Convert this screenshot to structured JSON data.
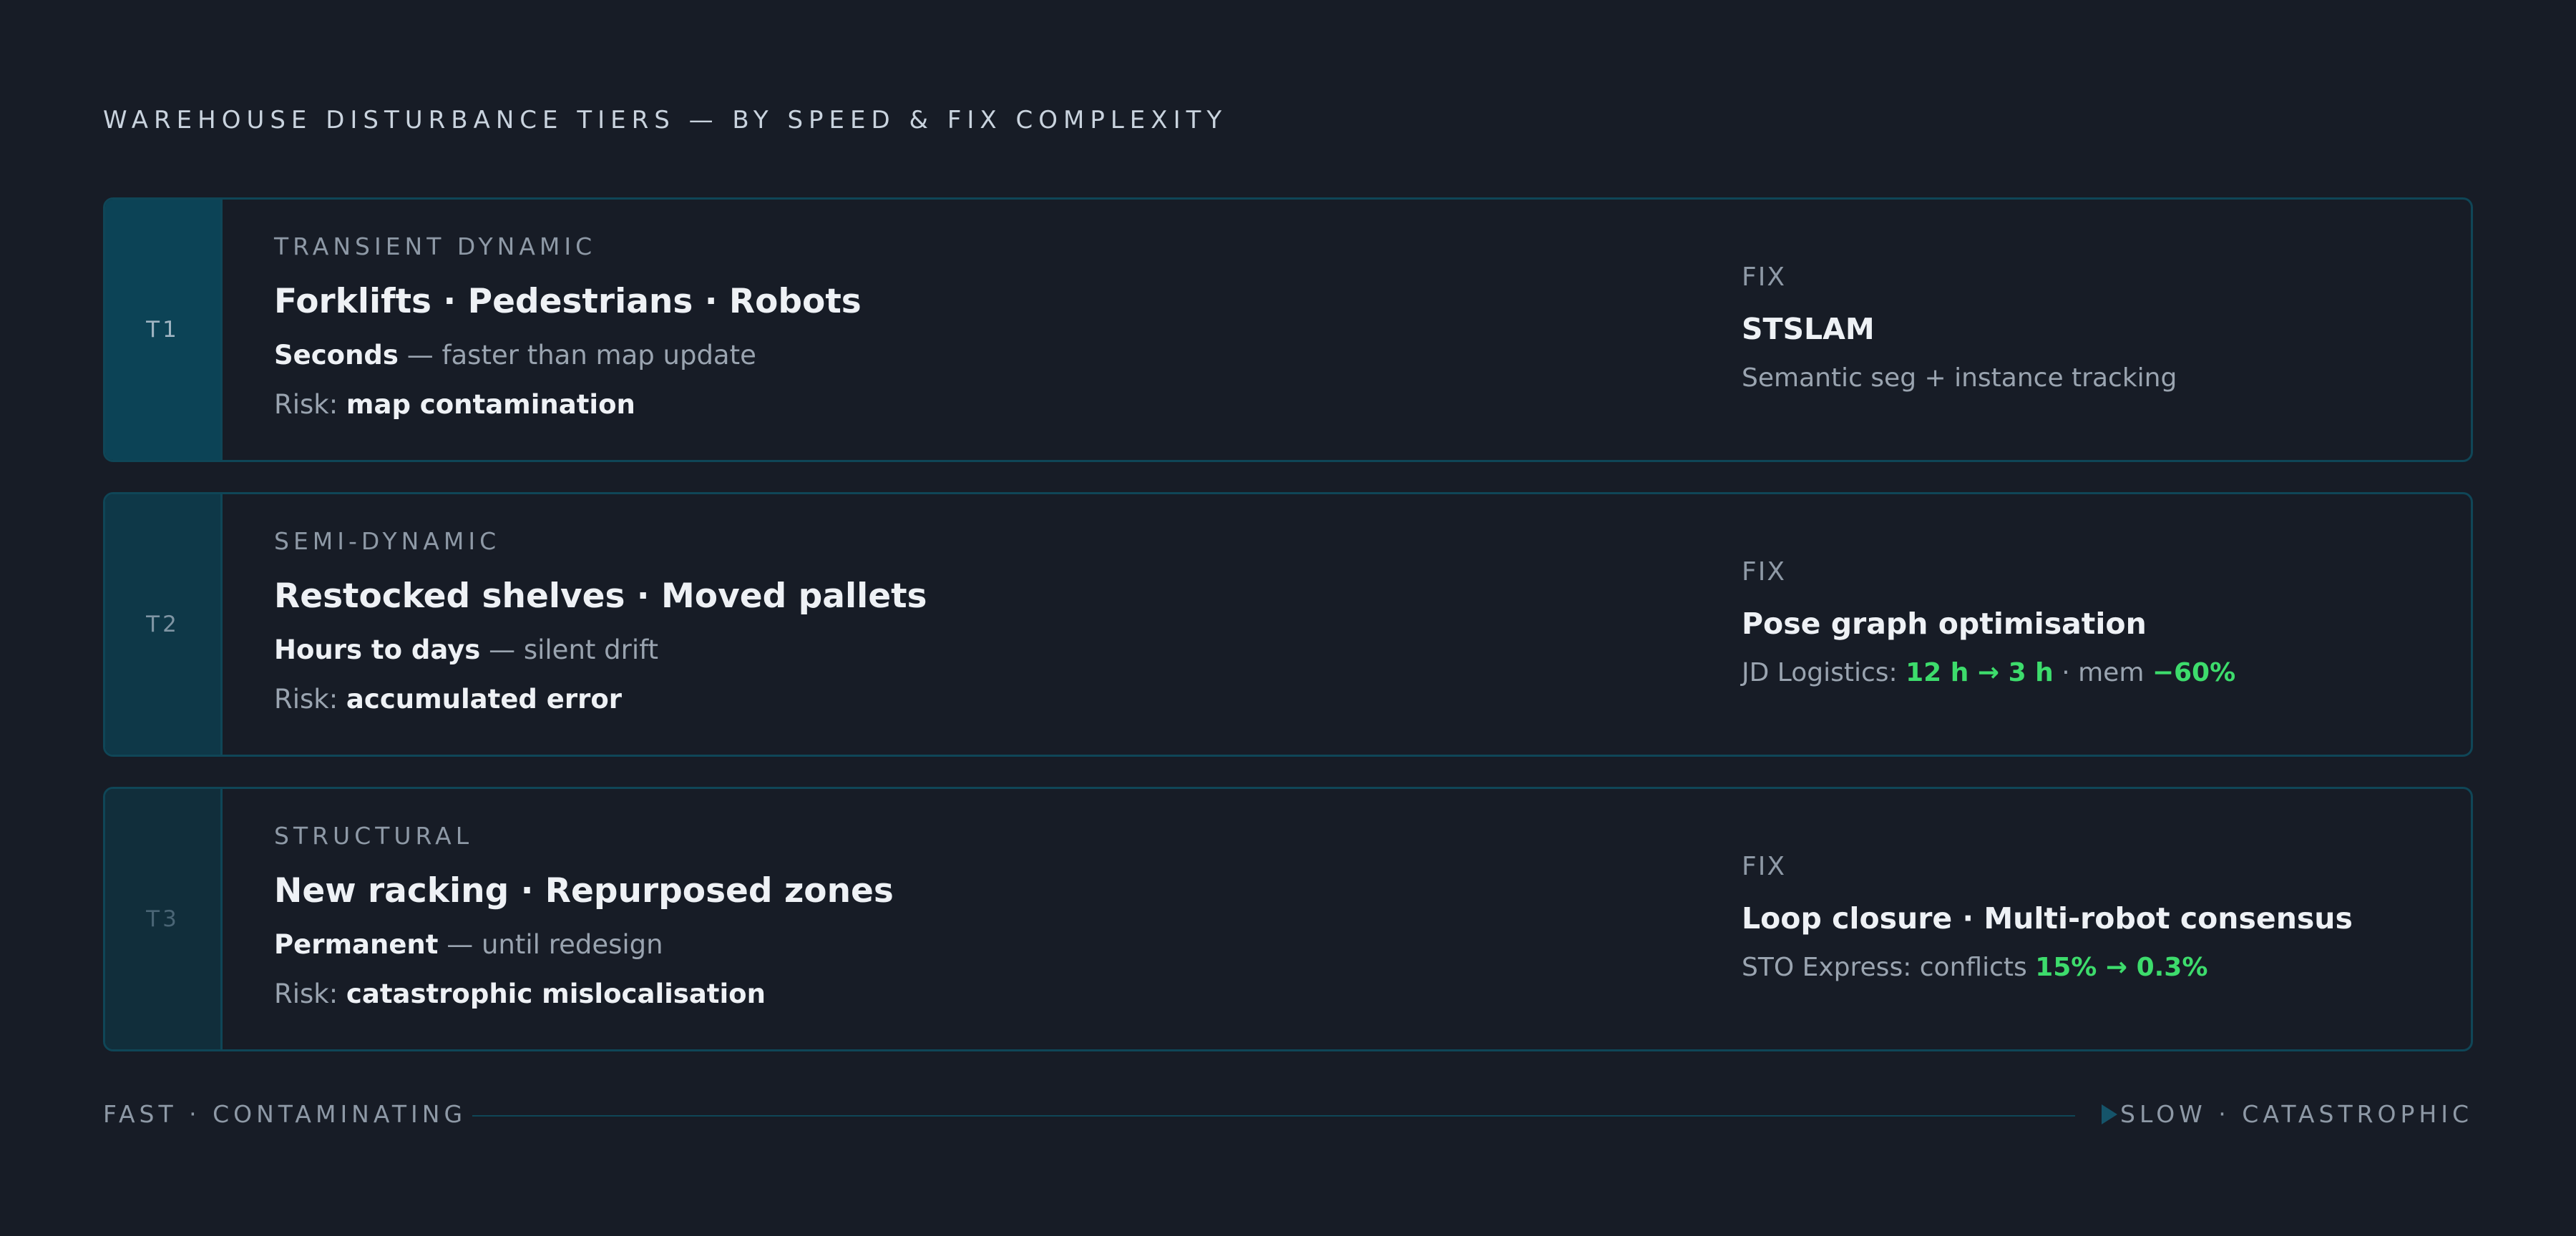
{
  "title": "WAREHOUSE DISTURBANCE TIERS — BY SPEED & FIX COMPLEXITY",
  "colors": {
    "background": "#171c26",
    "border": "#0f4657",
    "accent_green": "#3ddc6c",
    "badge_t1": "#0c4356",
    "badge_t2": "#0e3848",
    "badge_t3": "#112e3b"
  },
  "tiers": [
    {
      "badge": "T1",
      "kicker": "TRANSIENT DYNAMIC",
      "headline": "Forklifts · Pedestrians · Robots",
      "speed_bold": "Seconds",
      "speed_rest": " — faster than map update",
      "risk_prefix": "Risk: ",
      "risk_bold": "map contamination",
      "fix_label": "FIX",
      "fix_title": "STSLAM",
      "fix_detail_plain": "Semantic seg + instance tracking"
    },
    {
      "badge": "T2",
      "kicker": "SEMI-DYNAMIC",
      "headline": "Restocked shelves · Moved pallets",
      "speed_bold": "Hours to days",
      "speed_rest": " — silent drift",
      "risk_prefix": "Risk: ",
      "risk_bold": "accumulated error",
      "fix_label": "FIX",
      "fix_title": "Pose graph optimisation",
      "fix_detail_prefix": "JD Logistics: ",
      "fix_detail_green1": "12 h → 3 h",
      "fix_detail_mid": " · mem ",
      "fix_detail_green2": "−60%"
    },
    {
      "badge": "T3",
      "kicker": "STRUCTURAL",
      "headline": "New racking · Repurposed zones",
      "speed_bold": "Permanent",
      "speed_rest": " — until redesign",
      "risk_prefix": "Risk: ",
      "risk_bold": "catastrophic mislocalisation",
      "fix_label": "FIX",
      "fix_title": "Loop closure · Multi-robot consensus",
      "fix_detail_prefix": "STO Express: conflicts ",
      "fix_detail_green1": "15% → 0.3%"
    }
  ],
  "axis": {
    "left": "FAST · CONTAMINATING",
    "right": "SLOW · CATASTROPHIC",
    "arrow_icon": "play-arrow-icon"
  }
}
